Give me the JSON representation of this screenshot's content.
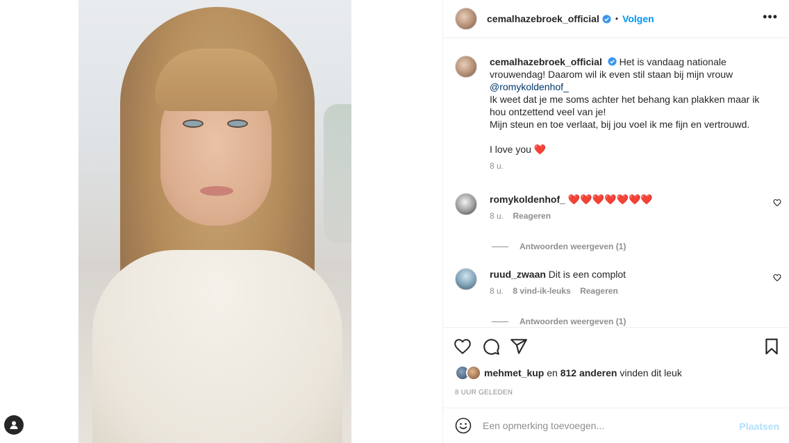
{
  "post": {
    "username": "cemalhazebroek_official",
    "follow_label": "Volgen",
    "separator": "•",
    "more_icon": "•••",
    "caption": {
      "line1": "Het is vandaag nationale vrouwendag! Daarom wil ik even stil staan bij mijn vrouw",
      "mention": "@romykoldenhof_",
      "line2": "Ik weet dat je me soms achter het behang kan plakken maar ik hou ontzettend veel van je!",
      "line3": "Mijn steun en toe verlaat, bij jou voel ik me fijn en vertrouwd.",
      "line4": "I love you ❤️",
      "time": "8 u."
    }
  },
  "comments": [
    {
      "username": "romykoldenhof_",
      "text": "❤️❤️❤️❤️❤️❤️❤️",
      "time": "8 u.",
      "likes": "",
      "reply_label": "Reageren",
      "view_replies": "Antwoorden weergeven (1)"
    },
    {
      "username": "ruud_zwaan",
      "text": "Dit is een complot",
      "time": "8 u.",
      "likes": "8 vind-ik-leuks",
      "reply_label": "Reageren",
      "view_replies": "Antwoorden weergeven (1)"
    }
  ],
  "likes_line": {
    "user": "mehmet_kup",
    "joiner": "en",
    "others": "812 anderen",
    "suffix": "vinden dit leuk"
  },
  "time_ago": "8 UUR GELEDEN",
  "add_comment": {
    "placeholder": "Een opmerking toevoegen...",
    "post_label": "Plaatsen"
  },
  "colors": {
    "accent": "#0095f6",
    "heart": "#ed4956",
    "muted": "#8e8e8e",
    "post_disabled": "#b2dffc"
  },
  "icons": [
    "verified-badge-icon",
    "more-options-icon",
    "heart-icon",
    "comment-icon",
    "share-icon",
    "bookmark-icon",
    "emoji-icon",
    "user-icon"
  ]
}
